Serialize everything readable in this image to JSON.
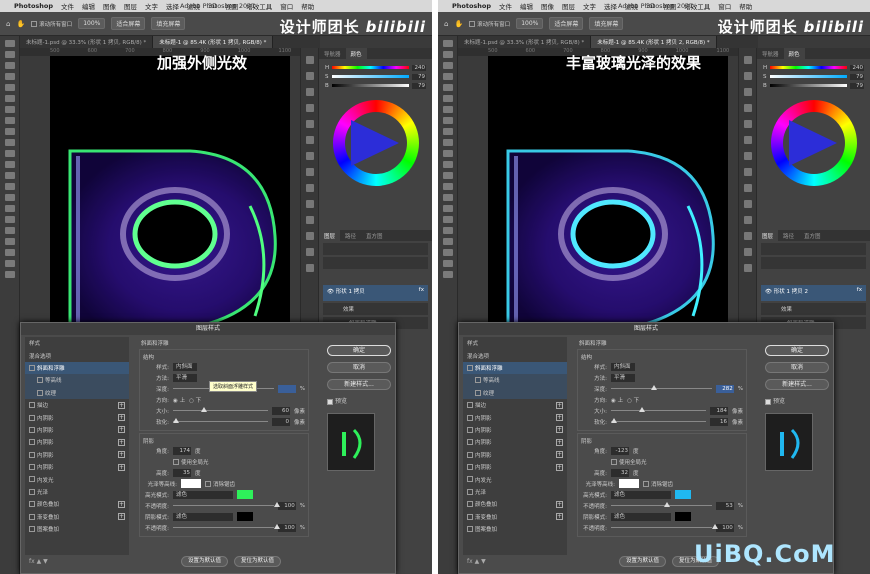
{
  "left": {
    "macbar": {
      "apple": "",
      "app": "Photoshop",
      "menus": [
        "文件",
        "编辑",
        "图像",
        "图层",
        "文字",
        "选择",
        "滤镜",
        "3D",
        "视图",
        "增效工具",
        "窗口",
        "帮助"
      ],
      "title": "Adobe Photoshop 2021"
    },
    "options": {
      "scroll_all": "滚动所有窗口",
      "zoom": "100%",
      "fit": "适合屏幕",
      "fill": "填充屏幕"
    },
    "brand": {
      "text": "设计师团长",
      "logo": "bilibili"
    },
    "tabs": [
      "未标题-1.psd @ 33.3% (形状 1 拷贝, RGB/8) *",
      "未标题-1 @ 85.4K (形状 1 拷贝, RGB/8) *"
    ],
    "ruler": [
      "500",
      "600",
      "700",
      "800",
      "900",
      "1000",
      "1100"
    ],
    "caption": "加强外侧光效",
    "panel": {
      "tabs": [
        "导航器",
        "颜色"
      ],
      "h": "240",
      "s": "79",
      "b": "79",
      "layer_tabs": [
        "图层",
        "路径",
        "直方图"
      ],
      "layer_name": "形状 1 拷贝",
      "effect": "效果",
      "effect_item": "斜面和浮雕"
    },
    "dialog": {
      "title": "图层样式",
      "list": [
        {
          "label": "样式",
          "sel": false,
          "plus": false,
          "sub": false
        },
        {
          "label": "混合选项",
          "sel": false,
          "plus": false,
          "sub": false
        },
        {
          "label": "斜面和浮雕",
          "sel": true,
          "plus": false,
          "sub": false
        },
        {
          "label": "等高线",
          "sel": false,
          "plus": false,
          "sub": true
        },
        {
          "label": "纹理",
          "sel": false,
          "plus": false,
          "sub": true
        },
        {
          "label": "描边",
          "sel": false,
          "plus": true,
          "sub": false
        },
        {
          "label": "内阴影",
          "sel": false,
          "plus": true,
          "sub": false
        },
        {
          "label": "内阴影",
          "sel": false,
          "plus": true,
          "sub": false
        },
        {
          "label": "内阴影",
          "sel": false,
          "plus": true,
          "sub": false
        },
        {
          "label": "内阴影",
          "sel": false,
          "plus": true,
          "sub": false
        },
        {
          "label": "内阴影",
          "sel": false,
          "plus": true,
          "sub": false
        },
        {
          "label": "内发光",
          "sel": false,
          "plus": false,
          "sub": false
        },
        {
          "label": "光泽",
          "sel": false,
          "plus": false,
          "sub": false
        },
        {
          "label": "颜色叠加",
          "sel": false,
          "plus": true,
          "sub": false
        },
        {
          "label": "渐变叠加",
          "sel": false,
          "plus": true,
          "sub": false
        },
        {
          "label": "图案叠加",
          "sel": false,
          "plus": false,
          "sub": false
        }
      ],
      "bevel_title": "斜面和浮雕",
      "struct": "结构",
      "style_lbl": "样式:",
      "style_val": "内斜面",
      "tech_lbl": "方法:",
      "tech_val": "平滑",
      "depth_lbl": "深度:",
      "depth_val": "",
      "depth_unit": "%",
      "dir_lbl": "方向:",
      "dir_up": "上",
      "dir_down": "下",
      "size_lbl": "大小:",
      "size_val": "60",
      "size_unit": "像素",
      "soft_lbl": "软化:",
      "soft_val": "0",
      "soft_unit": "像素",
      "shading": "阴影",
      "angle_lbl": "角度:",
      "angle_val": "174",
      "angle_unit": "度",
      "global_light": "使用全局光",
      "alt_lbl": "高度:",
      "alt_val": "35",
      "alt_unit": "度",
      "gloss_lbl": "光泽等高线:",
      "anti": "消除锯齿",
      "hl_lbl": "高光模式:",
      "hl_mode": "滤色",
      "hl_color": "#2ef05a",
      "hl_op_lbl": "不透明度:",
      "hl_op": "100",
      "sh_lbl": "阴影模式:",
      "sh_mode": "滤色",
      "sh_color": "#000000",
      "sh_op_lbl": "不透明度:",
      "sh_op": "100",
      "pct": "%",
      "ok": "确定",
      "cancel": "取消",
      "new_style": "新建样式...",
      "preview": "预览",
      "set_default": "设置为默认值",
      "reset_default": "复位为默认值",
      "tooltip": "选取斜面浮雕样式",
      "fx": "fx"
    },
    "status": "85.36%"
  },
  "right": {
    "macbar": {
      "apple": "",
      "app": "Photoshop",
      "menus": [
        "文件",
        "编辑",
        "图像",
        "图层",
        "文字",
        "选择",
        "滤镜",
        "3D",
        "视图",
        "增效工具",
        "窗口",
        "帮助"
      ],
      "title": "Adobe Photoshop 2021"
    },
    "options": {
      "scroll_all": "滚动所有窗口",
      "zoom": "100%",
      "fit": "适合屏幕",
      "fill": "填充屏幕"
    },
    "brand": {
      "text": "设计师团长",
      "logo": "bilibili"
    },
    "tabs": [
      "未标题-1.psd @ 33.3% (形状 1 拷贝, RGB/8) *",
      "未标题-1 @ 85.4K (形状 1 拷贝 2, RGB/8) *"
    ],
    "ruler": [
      "500",
      "600",
      "700",
      "800",
      "900",
      "1000",
      "1100"
    ],
    "caption": "丰富玻璃光泽的效果",
    "panel": {
      "tabs": [
        "导航器",
        "颜色"
      ],
      "h": "240",
      "s": "79",
      "b": "79",
      "layer_tabs": [
        "图层",
        "路径",
        "直方图"
      ],
      "layer_name": "形状 1 拷贝 2",
      "effect": "效果",
      "effect_item": "斜面和浮雕"
    },
    "dialog": {
      "title": "图层样式",
      "list": [
        {
          "label": "样式",
          "sel": false,
          "plus": false,
          "sub": false
        },
        {
          "label": "混合选项",
          "sel": false,
          "plus": false,
          "sub": false
        },
        {
          "label": "斜面和浮雕",
          "sel": true,
          "plus": false,
          "sub": false
        },
        {
          "label": "等高线",
          "sel": false,
          "plus": false,
          "sub": true
        },
        {
          "label": "纹理",
          "sel": false,
          "plus": false,
          "sub": true
        },
        {
          "label": "描边",
          "sel": false,
          "plus": true,
          "sub": false
        },
        {
          "label": "内阴影",
          "sel": false,
          "plus": true,
          "sub": false
        },
        {
          "label": "内阴影",
          "sel": false,
          "plus": true,
          "sub": false
        },
        {
          "label": "内阴影",
          "sel": false,
          "plus": true,
          "sub": false
        },
        {
          "label": "内阴影",
          "sel": false,
          "plus": true,
          "sub": false
        },
        {
          "label": "内阴影",
          "sel": false,
          "plus": true,
          "sub": false
        },
        {
          "label": "内发光",
          "sel": false,
          "plus": false,
          "sub": false
        },
        {
          "label": "光泽",
          "sel": false,
          "plus": false,
          "sub": false
        },
        {
          "label": "颜色叠加",
          "sel": false,
          "plus": true,
          "sub": false
        },
        {
          "label": "渐变叠加",
          "sel": false,
          "plus": true,
          "sub": false
        },
        {
          "label": "图案叠加",
          "sel": false,
          "plus": false,
          "sub": false
        }
      ],
      "bevel_title": "斜面和浮雕",
      "struct": "结构",
      "style_lbl": "样式:",
      "style_val": "内斜面",
      "tech_lbl": "方法:",
      "tech_val": "平滑",
      "depth_lbl": "深度:",
      "depth_val": "282",
      "depth_unit": "%",
      "dir_lbl": "方向:",
      "dir_up": "上",
      "dir_down": "下",
      "size_lbl": "大小:",
      "size_val": "184",
      "size_unit": "像素",
      "soft_lbl": "软化:",
      "soft_val": "16",
      "soft_unit": "像素",
      "shading": "阴影",
      "angle_lbl": "角度:",
      "angle_val": "-123",
      "angle_unit": "度",
      "global_light": "使用全局光",
      "alt_lbl": "高度:",
      "alt_val": "32",
      "alt_unit": "度",
      "gloss_lbl": "光泽等高线:",
      "anti": "消除锯齿",
      "hl_lbl": "高光模式:",
      "hl_mode": "滤色",
      "hl_color": "#20b8f0",
      "hl_op_lbl": "不透明度:",
      "hl_op": "53",
      "sh_lbl": "阴影模式:",
      "sh_mode": "滤色",
      "sh_color": "#000000",
      "sh_op_lbl": "不透明度:",
      "sh_op": "100",
      "pct": "%",
      "ok": "确定",
      "cancel": "取消",
      "new_style": "新建样式...",
      "preview": "预览",
      "set_default": "设置为默认值",
      "reset_default": "复位为默认值",
      "tooltip": "",
      "fx": "fx"
    },
    "status": "85.36%"
  },
  "watermark": "UiBQ.CoM"
}
